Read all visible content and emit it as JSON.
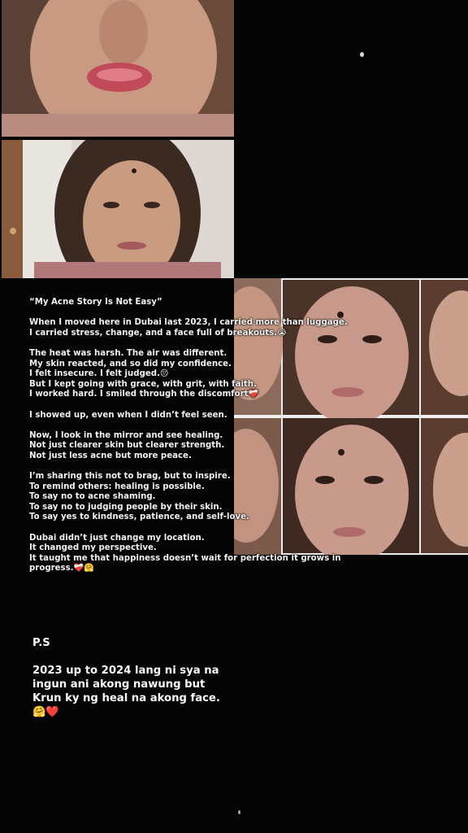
{
  "story": {
    "title": "“My Acne Story Is Not Easy”",
    "paragraphs": [
      [
        "When I moved here in Dubai last 2023, I carried more than luggage.",
        "I carried stress, change, and a face full of breakouts.😭"
      ],
      [
        "The heat was harsh. The air was different.",
        "My skin reacted, and so did my confidence.",
        "I felt insecure. I felt judged.😔",
        "But I kept going with grace, with grit, with faith.",
        "I worked hard. I smiled through the discomfort❤️‍🩹"
      ],
      [
        "I showed up, even when I didn’t feel seen."
      ],
      [
        "Now, I look in the mirror and see healing.",
        "Not just clearer skin but clearer strength.",
        "Not just less acne but more peace."
      ],
      [
        "I’m sharing this not to brag, but to inspire.",
        "To remind others: healing is possible.",
        "To say no to acne shaming.",
        "To say no to judging people by their skin.",
        "To say yes to kindness, patience, and self-love."
      ],
      [
        "Dubai didn’t just change my location.",
        "It changed my perspective.",
        "It taught me that happiness doesn’t wait for perfection it grows in",
        "progress.❤️‍🩹🤗"
      ]
    ]
  },
  "ps": {
    "title": "P.S",
    "lines": [
      "2023 up to 2024 lang ni sya na",
      "ingun ani akong nawung but",
      "Krun ky ng heal na akong face.",
      "🤗❤️"
    ]
  },
  "colors": {
    "background": "#050505",
    "text": "#f2f2f2"
  }
}
